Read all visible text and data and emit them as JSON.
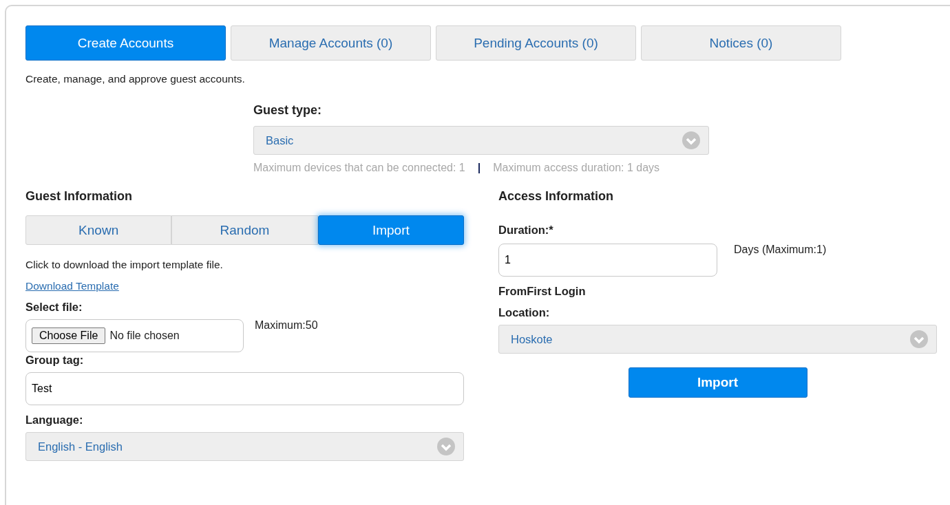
{
  "tabs": [
    {
      "label": "Create Accounts",
      "selected": true
    },
    {
      "label": "Manage Accounts (0)",
      "selected": false
    },
    {
      "label": "Pending Accounts (0)",
      "selected": false
    },
    {
      "label": "Notices (0)",
      "selected": false
    }
  ],
  "description": "Create, manage, and approve guest accounts.",
  "guest_type": {
    "label": "Guest type:",
    "value": "Basic",
    "max_devices": "Maximum devices that can be connected: 1",
    "separator": "|",
    "max_duration": "Maximum access duration: 1 days"
  },
  "guest_information": {
    "title": "Guest Information",
    "modes": [
      {
        "label": "Known",
        "selected": false
      },
      {
        "label": "Random",
        "selected": false
      },
      {
        "label": "Import",
        "selected": true
      }
    ],
    "hint": "Click to download the import template file.",
    "link": "Download Template",
    "select_file": {
      "label": "Select file:",
      "button": "Choose File",
      "status": "No file chosen",
      "note": "Maximum:50"
    },
    "group_tag": {
      "label": "Group tag:",
      "value": "Test"
    },
    "language": {
      "label": "Language:",
      "value": "English - English"
    }
  },
  "access_information": {
    "title": "Access Information",
    "duration": {
      "label": "Duration:*",
      "value": "1",
      "note": "Days (Maximum:1)"
    },
    "start": "FromFirst Login",
    "location": {
      "label": "Location:",
      "value": "Hoskote"
    },
    "submit": "Import"
  }
}
